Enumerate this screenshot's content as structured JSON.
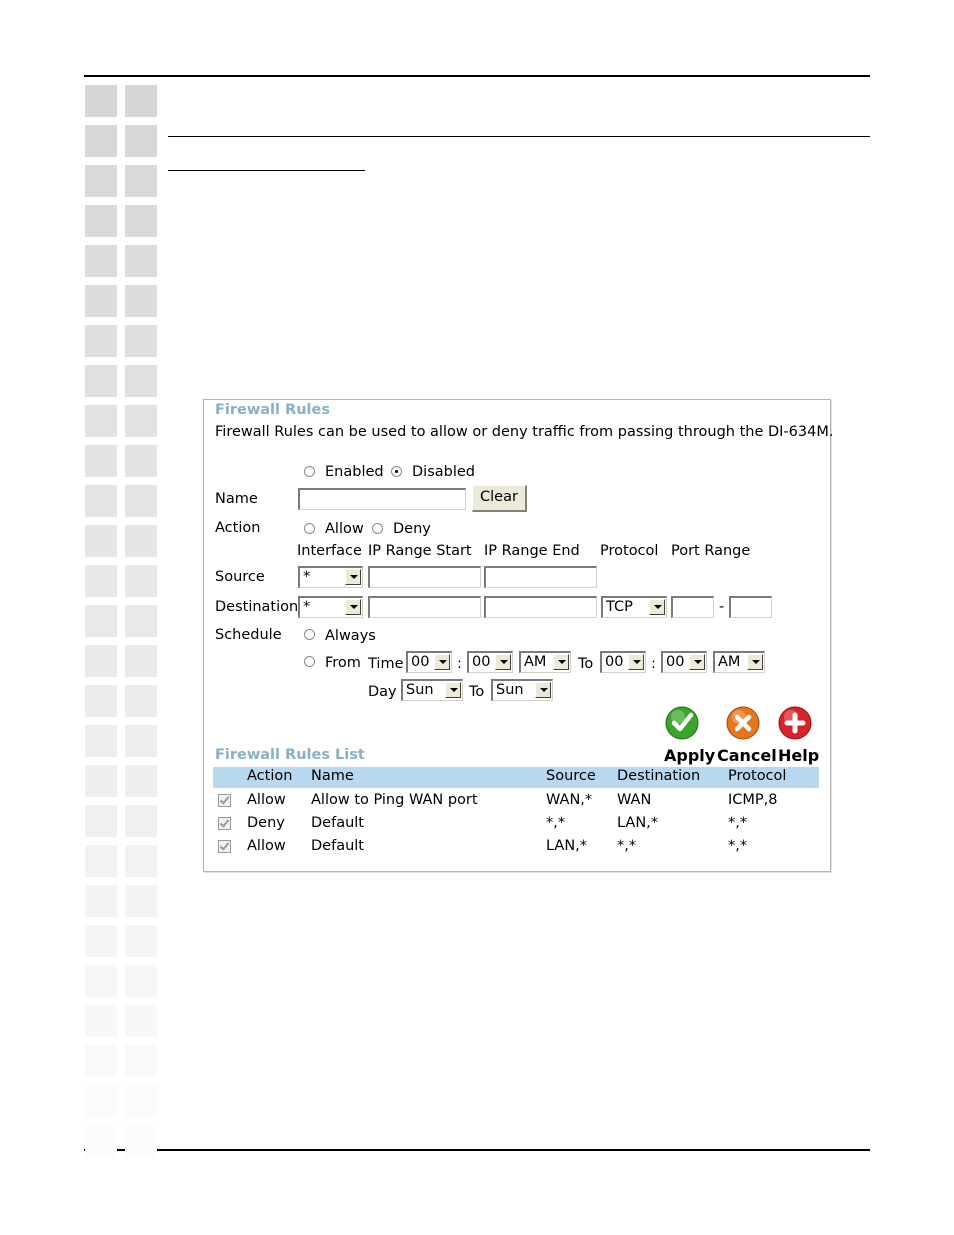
{
  "firewall": {
    "title": "Firewall Rules",
    "description": "Firewall Rules can be used to allow or deny traffic from passing through the DI-634M.",
    "status_enabled": "Enabled",
    "status_disabled": "Disabled",
    "name_label": "Name",
    "name_value": "",
    "clear_label": "Clear",
    "action_label": "Action",
    "action_allow": "Allow",
    "action_deny": "Deny",
    "col_interface": "Interface",
    "col_ip_start": "IP Range Start",
    "col_ip_end": "IP Range End",
    "col_protocol": "Protocol",
    "col_port_range": "Port Range",
    "source_label": "Source",
    "source_interface": "*",
    "destination_label": "Destination",
    "destination_interface": "*",
    "destination_protocol": "TCP",
    "port_dash": "-",
    "schedule_label": "Schedule",
    "schedule_always": "Always",
    "schedule_from": "From",
    "time_label": "Time",
    "from_hour": "00",
    "from_minute": "00",
    "from_ampm": "AM",
    "to_label": "To",
    "to_hour": "00",
    "to_minute": "00",
    "to_ampm": "AM",
    "colon": ":",
    "day_label": "Day",
    "from_day": "Sun",
    "to_day_label": "To",
    "to_day": "Sun",
    "apply_label": "Apply",
    "cancel_label": "Cancel",
    "help_label": "Help"
  },
  "rules_list": {
    "title": "Firewall Rules List",
    "headers": {
      "action": "Action",
      "name": "Name",
      "source": "Source",
      "destination": "Destination",
      "protocol": "Protocol"
    },
    "rows": [
      {
        "action": "Allow",
        "name": "Allow to Ping WAN port",
        "source": "WAN,*",
        "destination": "WAN",
        "protocol": "ICMP,8"
      },
      {
        "action": "Deny",
        "name": "Default",
        "source": "*,*",
        "destination": "LAN,*",
        "protocol": "*,*"
      },
      {
        "action": "Allow",
        "name": "Default",
        "source": "LAN,*",
        "destination": "*,*",
        "protocol": "*,*"
      }
    ]
  },
  "colors": {
    "section_title": "#8ab0c6",
    "list_header_bg": "#b8d8f0",
    "apply_icon": "#3aa52a",
    "cancel_icon": "#e8741c",
    "help_icon": "#d8232a"
  }
}
